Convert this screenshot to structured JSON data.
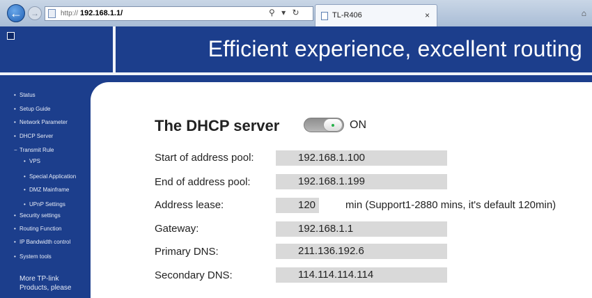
{
  "browser": {
    "url_prefix": "http://",
    "url_host": "192.168.1.1/",
    "tab_title": "TL-R406",
    "tab_close": "×",
    "addr_tools": [
      "⚲",
      "▾",
      "↻"
    ]
  },
  "header": {
    "slogan": "Efficient experience, excellent routing"
  },
  "sidebar": {
    "items": [
      {
        "label": "Status",
        "bullet": "•"
      },
      {
        "label": "Setup Guide",
        "bullet": "•"
      },
      {
        "label": "Network Parameter",
        "bullet": "•"
      },
      {
        "label": "DHCP Server",
        "bullet": "•"
      },
      {
        "label": "Transmit Rule",
        "bullet": "−"
      },
      {
        "label": "VPS",
        "bullet": "•"
      },
      {
        "label": "Special Application",
        "bullet": "•"
      },
      {
        "label": "DMZ Mainframe",
        "bullet": "•"
      },
      {
        "label": "UPnP Settings",
        "bullet": "•"
      },
      {
        "label": "Security settings",
        "bullet": "•"
      },
      {
        "label": "Routing Function",
        "bullet": "•"
      },
      {
        "label": "IP Bandwidth control",
        "bullet": "•"
      },
      {
        "label": "System tools",
        "bullet": "•"
      }
    ],
    "more_line1": "More TP-link",
    "more_line2": "Products, please"
  },
  "dhcp": {
    "title": "The DHCP server",
    "state": "ON",
    "enabled": true,
    "fields": {
      "start_label": "Start of address pool:",
      "start_value": "192.168.1.100",
      "end_label": "End  of address pool:",
      "end_value": "192.168.1.199",
      "lease_label": "Address lease:",
      "lease_value": "120",
      "lease_suffix": "min (Support1-2880 mins, it's default 120min)",
      "gateway_label": "Gateway:",
      "gateway_value": "192.168.1.1",
      "primary_dns_label": "Primary DNS:",
      "primary_dns_value": "211.136.192.6",
      "secondary_dns_label": "Secondary DNS:",
      "secondary_dns_value": "114.114.114.114"
    }
  },
  "colors": {
    "brand_blue": "#1c3e8c",
    "field_gray": "#d9d9d9",
    "toggle_dot": "#27b24a"
  }
}
